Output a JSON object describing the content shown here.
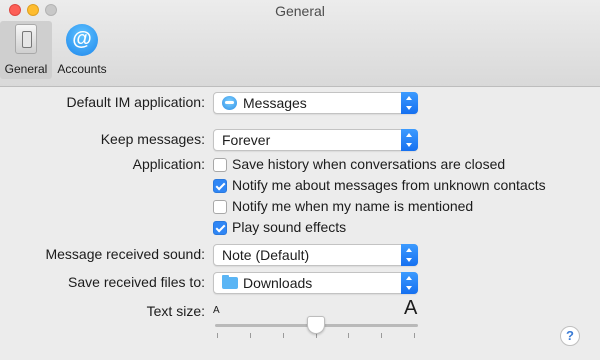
{
  "window": {
    "title": "General"
  },
  "toolbar": {
    "tabs": [
      {
        "label": "General"
      },
      {
        "label": "Accounts"
      }
    ]
  },
  "settings": {
    "default_im": {
      "label": "Default IM application:",
      "value": "Messages"
    },
    "keep_messages": {
      "label": "Keep messages:",
      "value": "Forever"
    },
    "application": {
      "label": "Application:",
      "options": [
        {
          "label": "Save history when conversations are closed",
          "checked": false
        },
        {
          "label": "Notify me about messages from unknown contacts",
          "checked": true
        },
        {
          "label": "Notify me when my name is mentioned",
          "checked": false
        },
        {
          "label": "Play sound effects",
          "checked": true
        }
      ]
    },
    "received_sound": {
      "label": "Message received sound:",
      "value": "Note (Default)"
    },
    "save_files": {
      "label": "Save received files to:",
      "value": "Downloads"
    },
    "text_size": {
      "label": "Text size:",
      "small_label": "A",
      "large_label": "A",
      "level_fraction": 0.5,
      "tick_count": 7
    }
  },
  "help": {
    "glyph": "?"
  },
  "colors": {
    "accent": "#2f86f5",
    "stepper": "#1670f0"
  }
}
